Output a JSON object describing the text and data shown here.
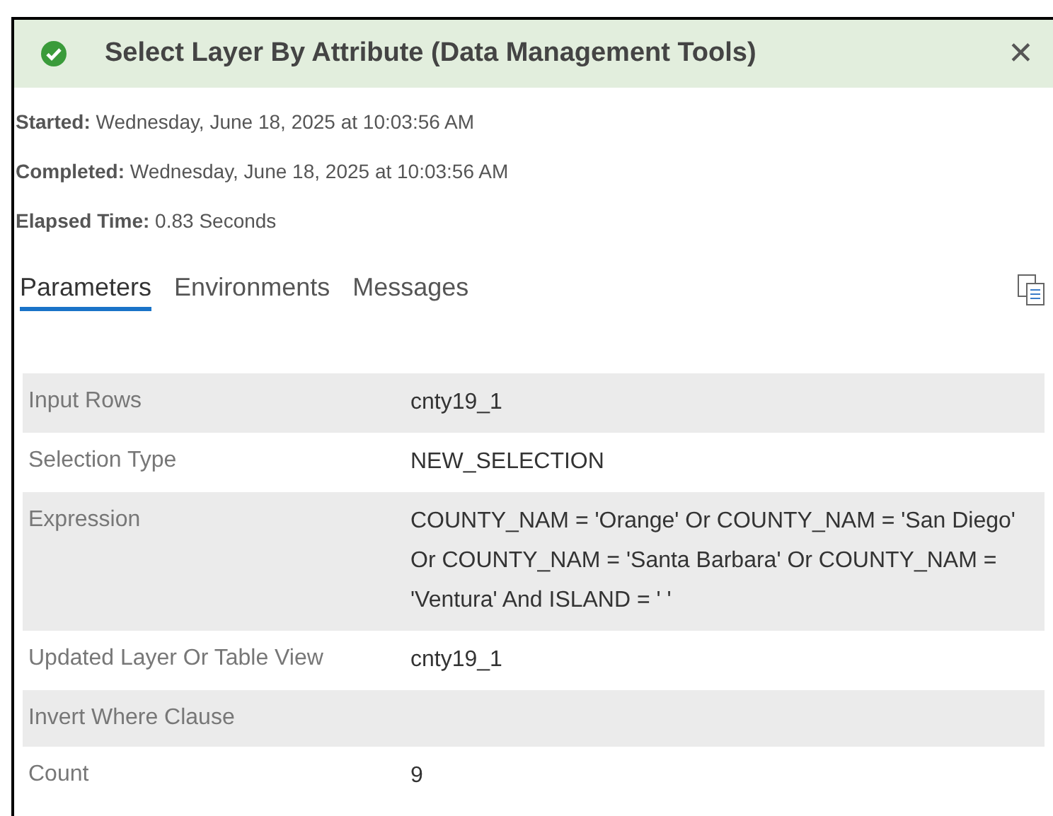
{
  "header": {
    "succeeded": true,
    "title": "Select Layer By Attribute (Data Management Tools)",
    "close": "✕"
  },
  "info": [
    "**Started:** Wednesday, June 18, 2025 at 10:03:56 AM",
    "**Completed:** Wednesday, June 18, 2025 at 10:03:56 AM",
    "**Elapsed Time:** 0.83 Seconds"
  ],
  "tabs": [
    {
      "label": "Parameters",
      "selected": true
    },
    {
      "label": "Environments",
      "selected": false
    },
    {
      "label": "Messages",
      "selected": false
    }
  ],
  "parameters": [
    {
      "name": "Input Rows",
      "value": "cnty19_1"
    },
    {
      "name": "Selection Type",
      "value": "NEW_SELECTION"
    },
    {
      "name": "Expression",
      "value": "COUNTY_NAM = 'Orange' Or COUNTY_NAM = 'San Diego' Or COUNTY_NAM = 'Santa Barbara' Or COUNTY_NAM = 'Ventura' And ISLAND = ' '"
    },
    {
      "name": "Updated Layer Or Table View",
      "value": "cnty19_1"
    },
    {
      "name": "Invert Where Clause"
    },
    {
      "name": "Count",
      "value": "9"
    }
  ]
}
